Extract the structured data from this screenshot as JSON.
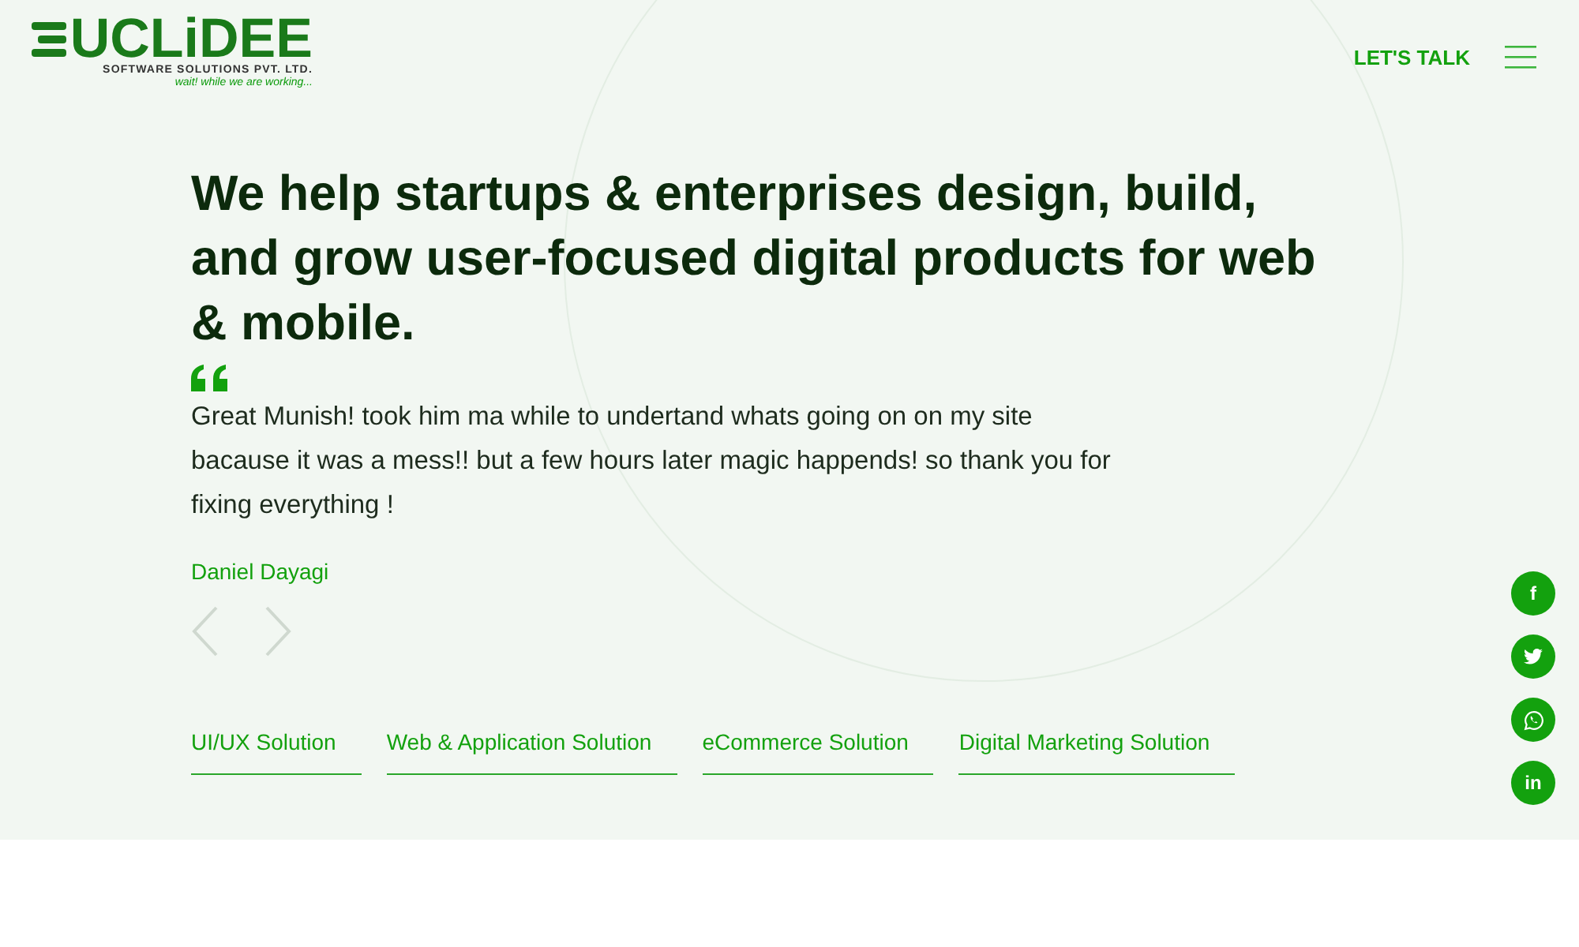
{
  "logo": {
    "wordmark": "UCLiDEE",
    "company": "SOFTWARE SOLUTIONS PVT. LTD.",
    "tagline": "wait! while we are working..."
  },
  "nav": {
    "cta": "LET'S TALK"
  },
  "hero": {
    "heading": "We help startups & enterprises design, build, and grow user-focused digital products for web & mobile.",
    "testimonial": {
      "quote": "Great Munish! took him ma while to undertand whats going on on my site bacause it was a mess!! but a few hours later magic happends! so thank you for fixing everything !",
      "author": "Daniel Dayagi"
    }
  },
  "services": [
    {
      "label": "UI/UX Solution"
    },
    {
      "label": "Web & Application Solution"
    },
    {
      "label": "eCommerce Solution"
    },
    {
      "label": "Digital Marketing Solution"
    }
  ],
  "social": [
    {
      "kind": "facebook",
      "glyph": "f"
    },
    {
      "kind": "twitter"
    },
    {
      "kind": "whatsapp"
    },
    {
      "kind": "linkedin",
      "glyph": "in"
    }
  ]
}
